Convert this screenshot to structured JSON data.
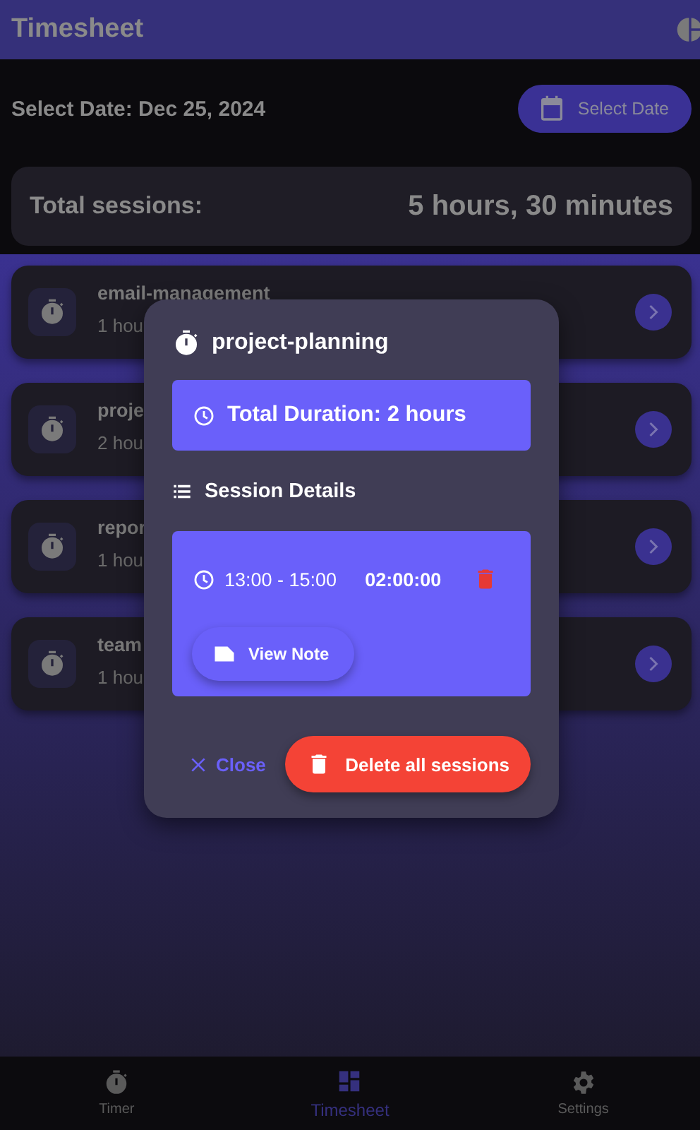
{
  "app_bar": {
    "title": "Timesheet"
  },
  "date_row": {
    "label": "Select Date: Dec 25, 2024",
    "button": "Select Date"
  },
  "summary": {
    "label": "Total sessions:",
    "value": "5 hours, 30 minutes"
  },
  "activities": [
    {
      "name": "email-management",
      "duration": "1 hou"
    },
    {
      "name": "proje",
      "duration": "2 hou"
    },
    {
      "name": "repor",
      "duration": "1 hou"
    },
    {
      "name": "team",
      "duration": "1 hou"
    }
  ],
  "dialog": {
    "title": "project-planning",
    "total": "Total Duration: 2 hours",
    "section": "Session Details",
    "sessions": [
      {
        "range": "13:00 - 15:00",
        "duration": "02:00:00",
        "note_button": "View Note"
      }
    ],
    "close": "Close",
    "delete_all": "Delete all sessions"
  },
  "bottom_nav": [
    {
      "label": "Timer",
      "selected": false
    },
    {
      "label": "Timesheet",
      "selected": true
    },
    {
      "label": "Settings",
      "selected": false
    }
  ]
}
